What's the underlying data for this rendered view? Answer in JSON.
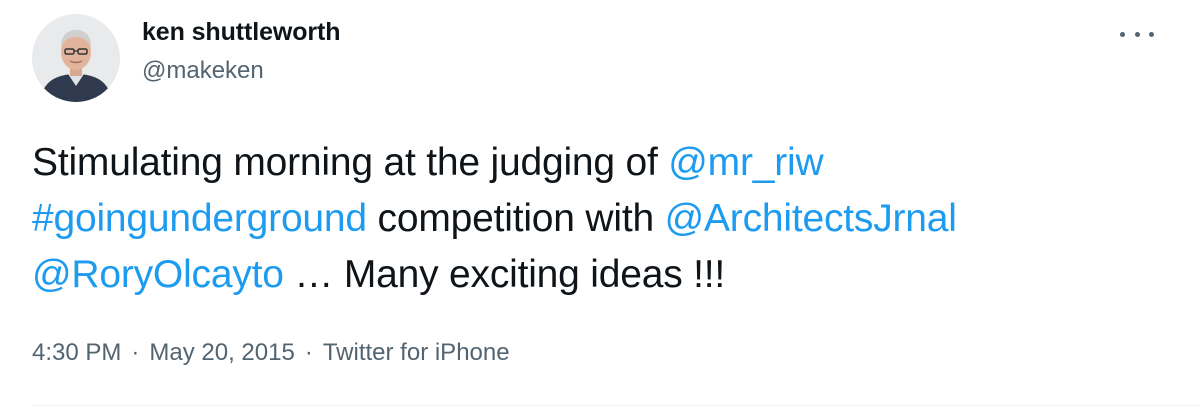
{
  "author": {
    "display_name": "ken shuttleworth",
    "handle": "@makeken"
  },
  "tweet": {
    "text_1": "Stimulating morning at the judging of ",
    "mention_1": "@mr_riw",
    "hashtag_1": "#goingunderground",
    "text_2": " competition with ",
    "mention_2": "@ArchitectsJrnal",
    "mention_3": "@RoryOlcayto",
    "text_3": " … Many exciting ideas !!!"
  },
  "meta": {
    "time": "4:30 PM",
    "separator": "·",
    "date": "May 20, 2015",
    "source": "Twitter for iPhone"
  },
  "colors": {
    "link": "#1d9bf0",
    "text": "#0f1419",
    "secondary": "#536471"
  },
  "icons": {
    "more": "more-horizontal-icon"
  }
}
